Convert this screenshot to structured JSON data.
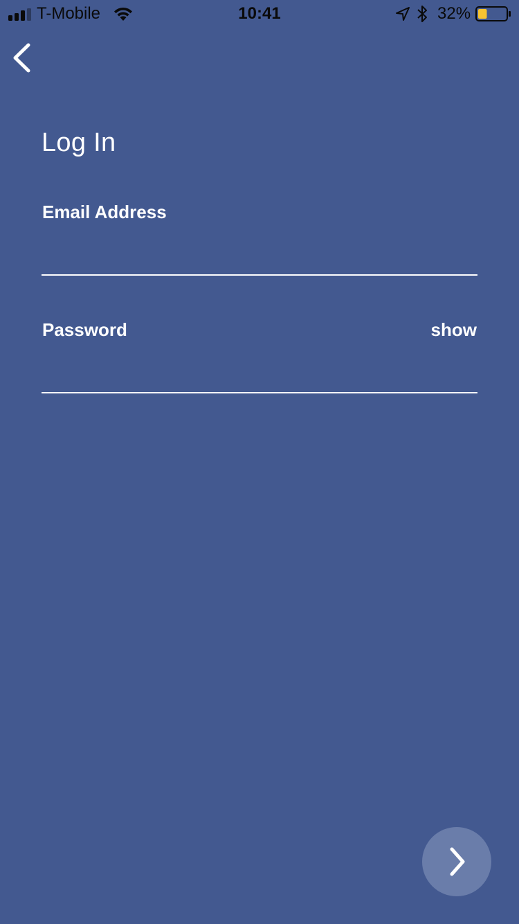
{
  "status_bar": {
    "carrier": "T-Mobile",
    "time": "10:41",
    "battery_percent": "32%",
    "battery_level": 0.32,
    "battery_color": "#f7c331",
    "icons": [
      "signal-icon",
      "wifi-icon",
      "location-icon",
      "bluetooth-icon",
      "battery-icon"
    ]
  },
  "header": {
    "back_icon": "chevron-left-icon"
  },
  "page": {
    "title": "Log In",
    "background_color": "#435990"
  },
  "form": {
    "email": {
      "label": "Email Address",
      "value": "",
      "placeholder": ""
    },
    "password": {
      "label": "Password",
      "value": "",
      "placeholder": "",
      "toggle_label": "show"
    }
  },
  "next_button": {
    "icon": "chevron-right-icon",
    "color": "#6a7daa"
  }
}
